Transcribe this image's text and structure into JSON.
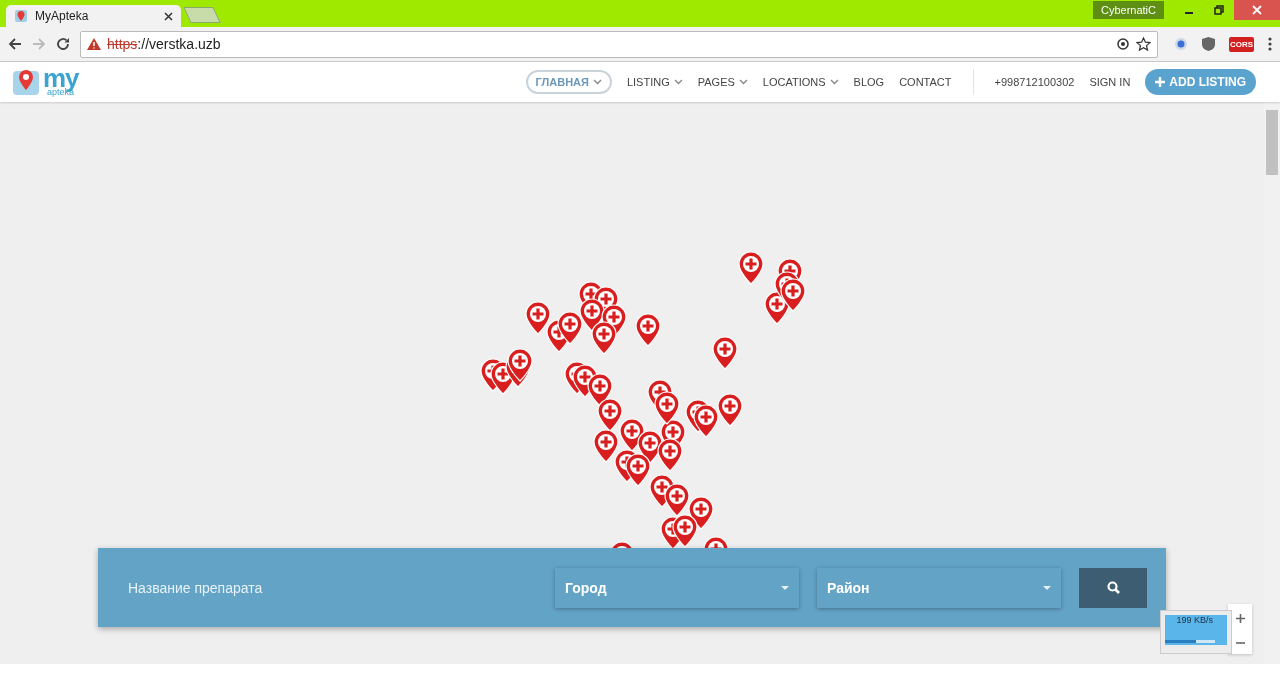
{
  "browser": {
    "tab_title": "MyApteka",
    "profile": "CybernatiC",
    "url_scheme": "https",
    "url_rest": "://verstka.uzb",
    "extension_badge": "CORS"
  },
  "nav": {
    "logo_main": "my",
    "logo_sub": "apteka",
    "items": [
      {
        "label": "ГЛАВНАЯ",
        "dropdown": true,
        "selected": true
      },
      {
        "label": "LISTING",
        "dropdown": true,
        "selected": false
      },
      {
        "label": "PAGES",
        "dropdown": true,
        "selected": false
      },
      {
        "label": "LOCATIONS",
        "dropdown": true,
        "selected": false
      },
      {
        "label": "BLOG",
        "dropdown": false,
        "selected": false
      },
      {
        "label": "CONTACT",
        "dropdown": false,
        "selected": false
      }
    ],
    "phone": "+998712100302",
    "sign_in": "SIGN IN",
    "add_listing": "ADD LISTING"
  },
  "search": {
    "placeholder": "Название препарата",
    "city": "Город",
    "district": "Район"
  },
  "speed_widget": {
    "reading": "199 KB/s",
    "level": 0.62
  }
}
